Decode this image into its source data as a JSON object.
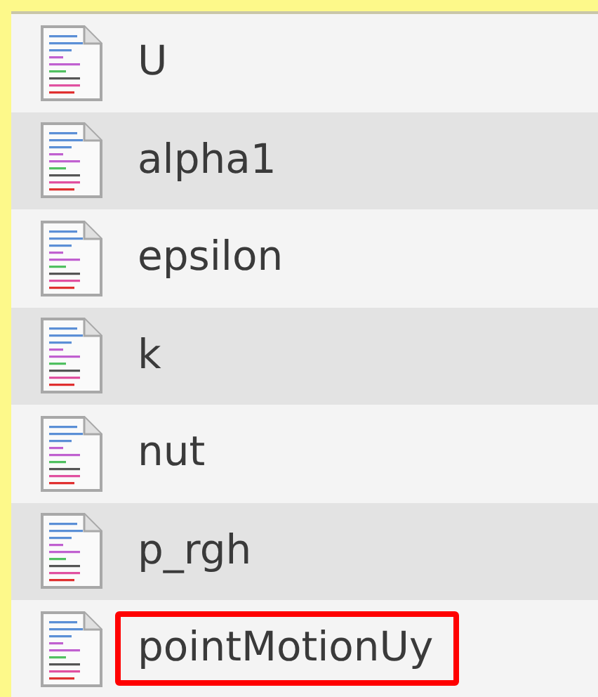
{
  "files": [
    {
      "name": "U",
      "highlighted": false
    },
    {
      "name": "alpha1",
      "highlighted": false
    },
    {
      "name": "epsilon",
      "highlighted": false
    },
    {
      "name": "k",
      "highlighted": false
    },
    {
      "name": "nut",
      "highlighted": false
    },
    {
      "name": "p_rgh",
      "highlighted": false
    },
    {
      "name": "pointMotionUy",
      "highlighted": true
    }
  ]
}
